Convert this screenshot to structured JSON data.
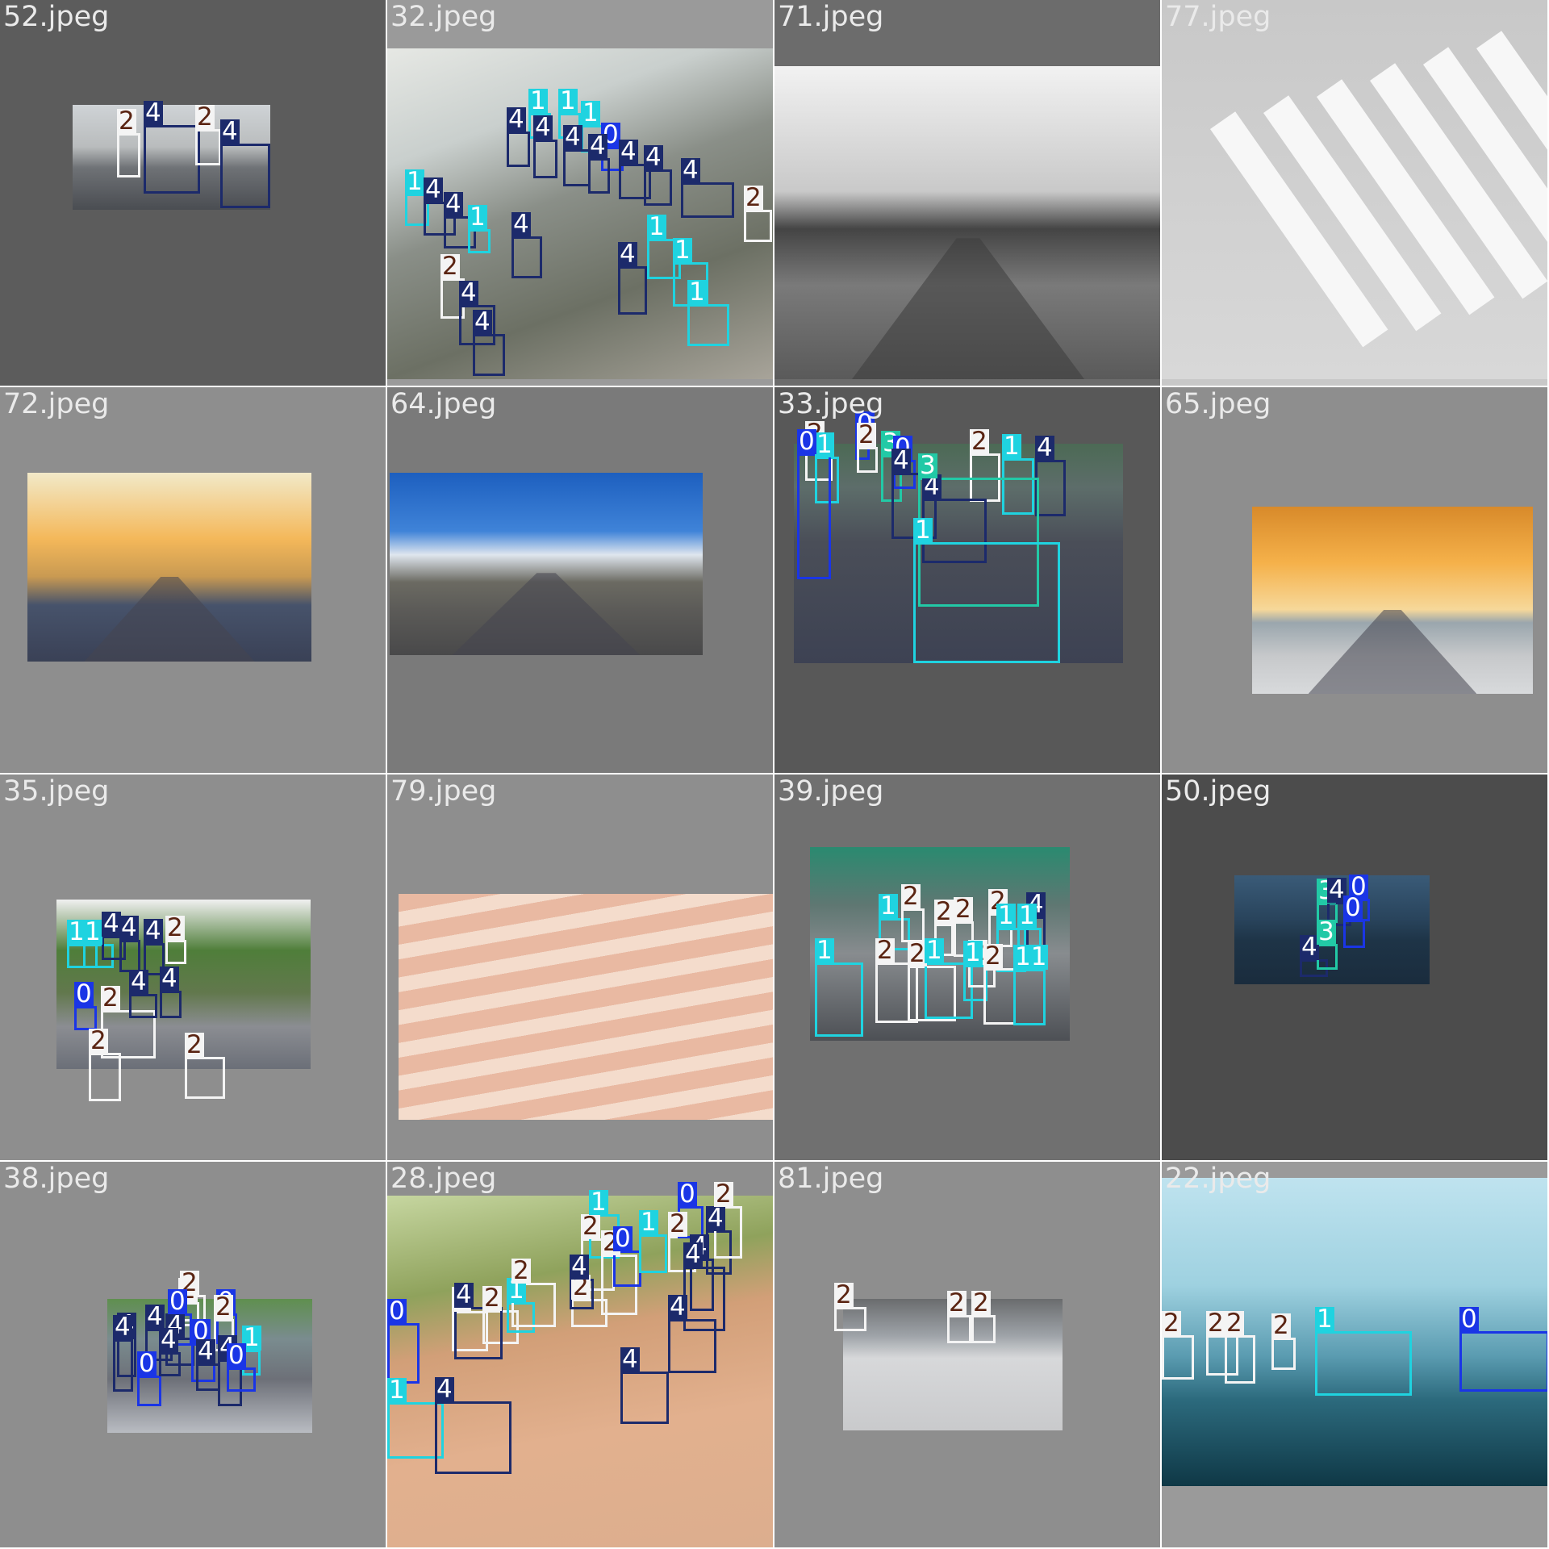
{
  "grid": {
    "tiles": [
      {
        "title": "52.jpeg",
        "background": "#5c5c5c"
      },
      {
        "title": "32.jpeg",
        "background": "#9a9a9a"
      },
      {
        "title": "71.jpeg",
        "background": "#6c6c6c"
      },
      {
        "title": "77.jpeg",
        "background": "#c8c8c8"
      },
      {
        "title": "72.jpeg",
        "background": "#8e8e8e"
      },
      {
        "title": "64.jpeg",
        "background": "#7a7a7a"
      },
      {
        "title": "33.jpeg",
        "background": "#585858"
      },
      {
        "title": "65.jpeg",
        "background": "#8e8e8e"
      },
      {
        "title": "35.jpeg",
        "background": "#8e8e8e"
      },
      {
        "title": "79.jpeg",
        "background": "#8e8e8e"
      },
      {
        "title": "39.jpeg",
        "background": "#707070"
      },
      {
        "title": "50.jpeg",
        "background": "#4c4c4c"
      },
      {
        "title": "38.jpeg",
        "background": "#8e8e8e"
      },
      {
        "title": "28.jpeg",
        "background": "#8e8e8e"
      },
      {
        "title": "81.jpeg",
        "background": "#8e8e8e"
      },
      {
        "title": "22.jpeg",
        "background": "#9a9a9a"
      }
    ]
  },
  "legend": {
    "class_colors": {
      "0": {
        "box": "#1a35e6",
        "tag_bg": "#1a35e6",
        "tag_fg": "#ffffff"
      },
      "1": {
        "box": "#1fd3e0",
        "tag_bg": "#1fd3e0",
        "tag_fg": "#ffffff"
      },
      "2": {
        "box": "#f4f4f4",
        "tag_bg": "#f4f4f4",
        "tag_fg": "#5a2412"
      },
      "3": {
        "box": "#22c9a6",
        "tag_bg": "#22c9a6",
        "tag_fg": "#ffffff"
      },
      "4": {
        "box": "#1c2a6b",
        "tag_bg": "#1c2a6b",
        "tag_fg": "#ffffff"
      }
    }
  },
  "detections": [
    [
      {
        "label": "2"
      },
      {
        "label": "4"
      },
      {
        "label": "2"
      },
      {
        "label": "4"
      }
    ],
    [
      {
        "label": "1"
      },
      {
        "label": "1"
      },
      {
        "label": "1"
      },
      {
        "label": "0"
      },
      {
        "label": "4"
      },
      {
        "label": "4"
      },
      {
        "label": "4"
      },
      {
        "label": "4"
      },
      {
        "label": "4"
      },
      {
        "label": "4"
      },
      {
        "label": "4"
      },
      {
        "label": "1"
      },
      {
        "label": "4"
      },
      {
        "label": "4"
      },
      {
        "label": "1"
      },
      {
        "label": "2"
      },
      {
        "label": "4"
      },
      {
        "label": "1"
      },
      {
        "label": "1"
      },
      {
        "label": "4"
      },
      {
        "label": "1"
      },
      {
        "label": "4"
      },
      {
        "label": "4"
      },
      {
        "label": "2"
      }
    ],
    [],
    [],
    [],
    [],
    [
      {
        "label": "2"
      },
      {
        "label": "1"
      },
      {
        "label": "0"
      },
      {
        "label": "2"
      },
      {
        "label": "0"
      },
      {
        "label": "3"
      },
      {
        "label": "0"
      },
      {
        "label": "4"
      },
      {
        "label": "2"
      },
      {
        "label": "1"
      },
      {
        "label": "4"
      },
      {
        "label": "4"
      },
      {
        "label": "3"
      },
      {
        "label": "1"
      }
    ],
    [],
    [
      {
        "label": "1"
      },
      {
        "label": "1"
      },
      {
        "label": "4"
      },
      {
        "label": "4"
      },
      {
        "label": "4"
      },
      {
        "label": "2"
      },
      {
        "label": "2"
      },
      {
        "label": "4"
      },
      {
        "label": "4"
      },
      {
        "label": "0"
      },
      {
        "label": "2"
      },
      {
        "label": "2"
      }
    ],
    [],
    [
      {
        "label": "1"
      },
      {
        "label": "1"
      },
      {
        "label": "2"
      },
      {
        "label": "2"
      },
      {
        "label": "2"
      },
      {
        "label": "2"
      },
      {
        "label": "1"
      },
      {
        "label": "4"
      },
      {
        "label": "1"
      },
      {
        "label": "2"
      },
      {
        "label": "2"
      },
      {
        "label": "1"
      },
      {
        "label": "2"
      },
      {
        "label": "1"
      },
      {
        "label": "2"
      },
      {
        "label": "11"
      }
    ],
    [
      {
        "label": "4"
      },
      {
        "label": "3"
      },
      {
        "label": "4"
      },
      {
        "label": "0"
      },
      {
        "label": "3"
      },
      {
        "label": "0"
      }
    ],
    [
      {
        "label": "4"
      },
      {
        "label": "4"
      },
      {
        "label": "2"
      },
      {
        "label": "2"
      },
      {
        "label": "0"
      },
      {
        "label": "4"
      },
      {
        "label": "4"
      },
      {
        "label": "0"
      },
      {
        "label": "0"
      },
      {
        "label": "2"
      },
      {
        "label": "4"
      },
      {
        "label": "1"
      },
      {
        "label": "0"
      },
      {
        "label": "4"
      },
      {
        "label": "0"
      },
      {
        "label": "4"
      }
    ],
    [
      {
        "label": "0"
      },
      {
        "label": "2"
      },
      {
        "label": "2"
      },
      {
        "label": "2"
      },
      {
        "label": "1"
      },
      {
        "label": "2"
      },
      {
        "label": "2"
      },
      {
        "label": "1"
      },
      {
        "label": "4"
      },
      {
        "label": "2"
      },
      {
        "label": "0"
      },
      {
        "label": "1"
      },
      {
        "label": "2"
      },
      {
        "label": "4"
      },
      {
        "label": "0"
      },
      {
        "label": "4"
      },
      {
        "label": "4"
      },
      {
        "label": "2"
      },
      {
        "label": "4"
      },
      {
        "label": "1"
      },
      {
        "label": "4"
      },
      {
        "label": "4"
      },
      {
        "label": "4"
      }
    ],
    [
      {
        "label": "2"
      },
      {
        "label": "2"
      },
      {
        "label": "2"
      }
    ],
    [
      {
        "label": "2"
      },
      {
        "label": "2"
      },
      {
        "label": "2"
      },
      {
        "label": "2"
      },
      {
        "label": "1"
      },
      {
        "label": "0"
      }
    ]
  ]
}
